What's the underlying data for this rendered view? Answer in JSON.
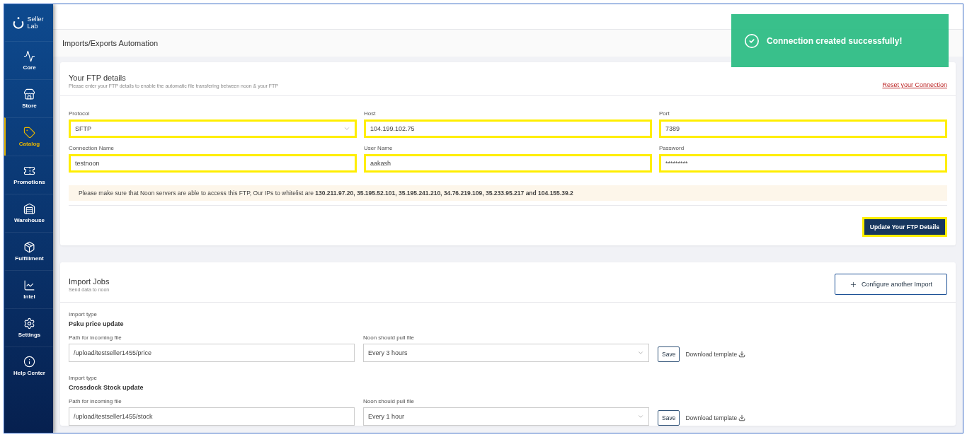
{
  "sidebar": {
    "logo": "Seller Lab",
    "items": [
      {
        "label": "Core",
        "selected": false
      },
      {
        "label": "Store",
        "selected": false
      },
      {
        "label": "Catalog",
        "selected": true
      },
      {
        "label": "Promotions",
        "selected": false
      },
      {
        "label": "Warehouse",
        "selected": false
      },
      {
        "label": "Fulfillment",
        "selected": false
      },
      {
        "label": "Intel",
        "selected": false
      },
      {
        "label": "Settings",
        "selected": false
      },
      {
        "label": "Help Center",
        "selected": false
      }
    ]
  },
  "page_title": "Imports/Exports Automation",
  "toast": {
    "message": "Connection created successfully!"
  },
  "ftp": {
    "title": "Your FTP details",
    "subtitle": "Please enter your FTP details to enable the automatic file transfering between noon & your FTP",
    "reset_link": "Reset your Connection",
    "fields": [
      {
        "label": "Protocol",
        "value": "SFTP",
        "kind": "select",
        "highlighted": true
      },
      {
        "label": "Host",
        "value": "104.199.102.75",
        "kind": "text",
        "highlighted": true
      },
      {
        "label": "Port",
        "value": "7389",
        "kind": "text",
        "highlighted": true
      },
      {
        "label": "Connection Name",
        "value": "testnoon",
        "kind": "text",
        "highlighted": true
      },
      {
        "label": "User Name",
        "value": "aakash",
        "kind": "text",
        "highlighted": true
      },
      {
        "label": "Password",
        "value": "*********",
        "kind": "password",
        "highlighted": true
      }
    ],
    "notice": "Please make sure that Noon servers are able to access this FTP, Our IPs to whitelist are  **130.211.97.20, 35.195.52.101, 35.195.241.210, 34.76.219.109, 35.233.95.217 and 104.155.39.2**",
    "button": {
      "label": "Update Your FTP Details",
      "highlighted": true
    }
  },
  "import_jobs": {
    "title": "Import Jobs",
    "subtitle": "Send data to noon",
    "add_button": "Configure another Import",
    "jobs": [
      {
        "type_label": "Import type",
        "type": "Psku price update",
        "path_label": "Path for incoming file",
        "path": "/upload/testseller1455/price",
        "schedule_label": "Noon should pull file",
        "schedule": "Every 3 hours",
        "save": "Save",
        "download": "Download template"
      },
      {
        "type_label": "Import type",
        "type": "Crossdock Stock update",
        "path_label": "Path for incoming file",
        "path": "/upload/testseller1455/stock",
        "schedule_label": "Noon should pull file",
        "schedule": "Every 1 hour",
        "save": "Save",
        "download": "Download template"
      }
    ]
  }
}
